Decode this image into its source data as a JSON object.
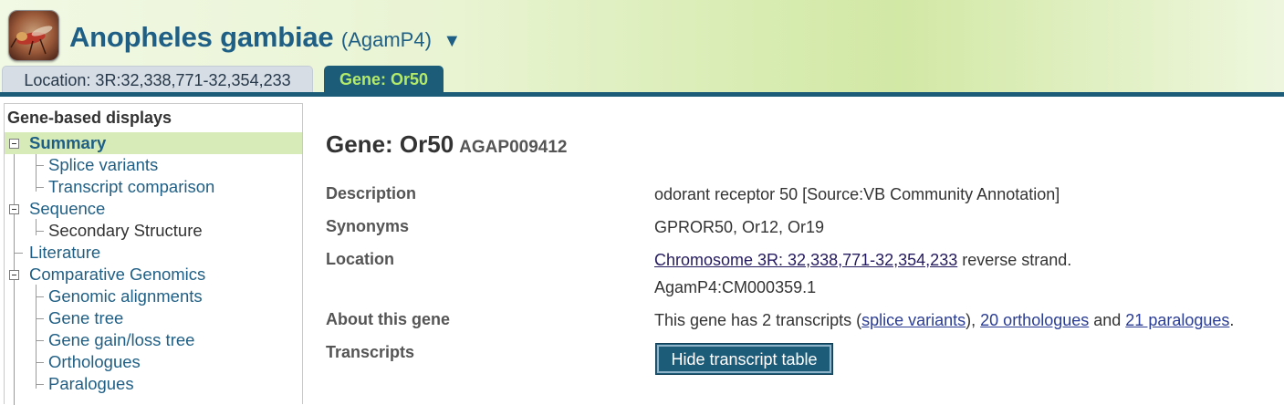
{
  "header": {
    "species_name": "Anopheles gambiae",
    "assembly": "(AgamP4)",
    "dropdown_caret": "▼",
    "colors": {
      "brand_blue": "#1f5f85",
      "tab_active_bg": "#1d5c79",
      "tab_active_text": "#b3ea6a"
    }
  },
  "tabs": [
    {
      "label": "Location: 3R:32,338,771-32,354,233",
      "active": false
    },
    {
      "label": "Gene: Or50",
      "active": true
    }
  ],
  "sidebar": {
    "header": "Gene-based displays",
    "items": [
      {
        "label": "Summary",
        "level": 0,
        "expanded": true,
        "active": true
      },
      {
        "label": "Splice variants",
        "level": 1
      },
      {
        "label": "Transcript comparison",
        "level": 1
      },
      {
        "label": "Sequence",
        "level": 0,
        "expanded": true
      },
      {
        "label": "Secondary Structure",
        "level": 1,
        "disabled": true
      },
      {
        "label": "Literature",
        "level": 0
      },
      {
        "label": "Comparative Genomics",
        "level": 0,
        "expanded": true
      },
      {
        "label": "Genomic alignments",
        "level": 1
      },
      {
        "label": "Gene tree",
        "level": 1
      },
      {
        "label": "Gene gain/loss tree",
        "level": 1
      },
      {
        "label": "Orthologues",
        "level": 1
      },
      {
        "label": "Paralogues",
        "level": 1
      }
    ]
  },
  "main": {
    "title": "Gene: Or50",
    "stable_id": "AGAP009412",
    "fields": {
      "description": {
        "label": "Description",
        "value": "odorant receptor 50 [Source:VB Community Annotation]"
      },
      "synonyms": {
        "label": "Synonyms",
        "value": "GPROR50, Or12, Or19"
      },
      "location": {
        "label": "Location",
        "link": "Chromosome 3R: 32,338,771-32,354,233",
        "suffix": " reverse strand.",
        "assembly_line": "AgamP4:CM000359.1"
      },
      "about": {
        "label": "About this gene",
        "prefix": "This gene has 2 transcripts (",
        "splice_link": "splice variants",
        "mid1": "), ",
        "orthologues_link": "20 orthologues",
        "mid2": " and ",
        "paralogues_link": "21 paralogues",
        "end": "."
      },
      "transcripts": {
        "label": "Transcripts",
        "button": "Hide transcript table"
      }
    }
  }
}
